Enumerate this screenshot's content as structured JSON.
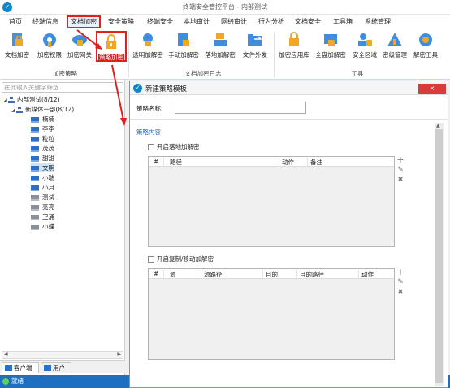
{
  "window": {
    "title": "终端安全管控平台 - 内部测试",
    "logo": "app-logo-icon"
  },
  "menu": [
    {
      "label": "首页"
    },
    {
      "label": "终端信息"
    },
    {
      "label": "文档加密"
    },
    {
      "label": "安全策略"
    },
    {
      "label": "终端安全"
    },
    {
      "label": "本地审计"
    },
    {
      "label": "网络审计"
    },
    {
      "label": "行为分析"
    },
    {
      "label": "文档安全"
    },
    {
      "label": "工具箱"
    },
    {
      "label": "系统管理"
    }
  ],
  "ribbon": {
    "buttons": [
      {
        "label": "文档加密",
        "icon": "doc-lock-icon"
      },
      {
        "label": "加密权限",
        "icon": "key-gear-icon"
      },
      {
        "label": "加密网关",
        "icon": "cloud-lock-icon"
      },
      {
        "label": "策略加密",
        "icon": "policy-lock-icon"
      },
      {
        "label": "透明加解密",
        "icon": "transparent-lock-icon"
      },
      {
        "label": "手动加解密",
        "icon": "manual-crypto-icon"
      },
      {
        "label": "落地加解密",
        "icon": "landing-crypto-icon"
      },
      {
        "label": "文件外发",
        "icon": "folder-send-icon"
      },
      {
        "label": "加密应用库",
        "icon": "app-lock-icon"
      },
      {
        "label": "全盘加解密",
        "icon": "disk-crypto-icon"
      },
      {
        "label": "安全区域",
        "icon": "safe-zone-icon"
      },
      {
        "label": "密级管理",
        "icon": "classification-icon"
      },
      {
        "label": "解密工具",
        "icon": "decrypt-tool-icon"
      }
    ],
    "groups": [
      {
        "label": "加密策略"
      },
      {
        "label": "文档加密日志"
      },
      {
        "label": "工具"
      }
    ]
  },
  "left": {
    "search_placeholder": "在此输入关键字筛选...",
    "tree": [
      {
        "label": "内部测试(8/12)",
        "kind": "org"
      },
      {
        "label": "新媒体一部(8/12)",
        "kind": "org"
      },
      {
        "label": "楠楠",
        "kind": "online"
      },
      {
        "label": "李李",
        "kind": "online"
      },
      {
        "label": "粒粒",
        "kind": "online"
      },
      {
        "label": "茂茂",
        "kind": "online"
      },
      {
        "label": "甜甜",
        "kind": "online"
      },
      {
        "label": "文明",
        "kind": "online"
      },
      {
        "label": "小瑞",
        "kind": "online"
      },
      {
        "label": "小月",
        "kind": "online"
      },
      {
        "label": "测试",
        "kind": "offline"
      },
      {
        "label": "亮亮",
        "kind": "offline"
      },
      {
        "label": "卫涌",
        "kind": "offline"
      },
      {
        "label": "小蝶",
        "kind": "offline"
      }
    ],
    "tabs": [
      {
        "label": "客户端"
      },
      {
        "label": "用户"
      }
    ]
  },
  "status": {
    "text": "就绪"
  },
  "dialog": {
    "title": "新建策略模板",
    "close_label": "×",
    "name_label": "策略名称:",
    "name_value": "",
    "section_title": "策略内容",
    "section1": {
      "checkbox_label": "开启落地加解密",
      "columns": [
        "#",
        "路径",
        "动作",
        "备注"
      ]
    },
    "section2": {
      "checkbox_label": "开启复制/移动加解密",
      "columns": [
        "#",
        "源",
        "源路径",
        "目的",
        "目的路径",
        "动作"
      ]
    },
    "tools": {
      "add": "+",
      "edit": "✎",
      "delete": "✖"
    },
    "scroll_arrow": "▲"
  }
}
